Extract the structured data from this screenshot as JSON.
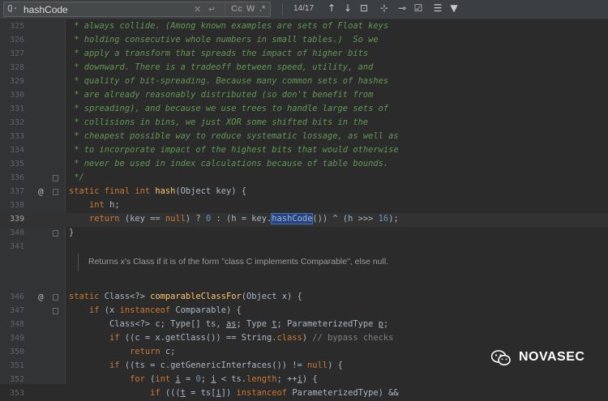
{
  "search": {
    "query": "hashCode",
    "magnifier_glyph": "Q·",
    "option_match_case": "Cc",
    "option_words": "W",
    "option_regex": ".*",
    "match_counter": "14/17"
  },
  "toolbar": {
    "icons": [
      "arrow-up-icon",
      "arrow-down-icon",
      "select-all-occurrences-icon",
      "add-occurrence-icon",
      "remove-occurrence-icon",
      "toggle-selection-icon",
      "show-filter-popup-icon",
      "filter-icon"
    ]
  },
  "editor": {
    "lines": [
      {
        "n": "325",
        "html": "<span class=\"cm\"> * always collide. (Among known examples are sets of Float keys</span>"
      },
      {
        "n": "326",
        "html": "<span class=\"cm\"> * holding consecutive whole numbers in small tables.)  So we</span>"
      },
      {
        "n": "327",
        "html": "<span class=\"cm\"> * apply a transform that spreads the impact of higher bits</span>"
      },
      {
        "n": "328",
        "html": "<span class=\"cm\"> * downward. There is a tradeoff between speed, utility, and</span>"
      },
      {
        "n": "329",
        "html": "<span class=\"cm\"> * quality of bit-spreading. Because many common sets of hashes</span>"
      },
      {
        "n": "330",
        "html": "<span class=\"cm\"> * are already reasonably distributed (so don't benefit from</span>"
      },
      {
        "n": "331",
        "html": "<span class=\"cm\"> * spreading), and because we use trees to handle large sets of</span>"
      },
      {
        "n": "332",
        "html": "<span class=\"cm\"> * collisions in bins, we just XOR some shifted bits in the</span>"
      },
      {
        "n": "333",
        "html": "<span class=\"cm\"> * cheapest possible way to reduce systematic lossage, as well as</span>"
      },
      {
        "n": "334",
        "html": "<span class=\"cm\"> * to incorporate impact of the highest bits that would otherwise</span>"
      },
      {
        "n": "335",
        "html": "<span class=\"cm\"> * never be used in index calculations because of table bounds.</span>"
      },
      {
        "n": "336",
        "html": "<span class=\"cm\"> */</span>"
      },
      {
        "n": "337",
        "html": "<span class=\"kw\">static final int</span> <span class=\"fn\">hash</span>(Object key) {"
      },
      {
        "n": "338",
        "html": "    <span class=\"kw\">int</span> h;"
      },
      {
        "n": "339",
        "html": "    <span class=\"kw\">return</span> (key == <span class=\"kw\">null</span>) ? <span class=\"num\">0</span> : (h = key.<span class=\"hl\">hashCode</span>()) ^ (h >>> <span class=\"num\">16</span>);"
      },
      {
        "n": "340",
        "html": "}"
      },
      {
        "n": "341",
        "html": ""
      },
      {
        "n": "",
        "html": ""
      },
      {
        "n": "346",
        "html": "<span class=\"kw\">static</span> Class&lt;?&gt; <span class=\"fn\">comparableClassFor</span>(Object x) {"
      },
      {
        "n": "347",
        "html": "    <span class=\"kw\">if</span> (x <span class=\"kw\">instanceof</span> Comparable) {"
      },
      {
        "n": "348",
        "html": "        Class&lt;?&gt; c; Type[] ts, <span class=\"ul\">as</span>; Type <span class=\"ul\">t</span>; ParameterizedType <span class=\"ul\">p</span>;"
      },
      {
        "n": "349",
        "html": "        <span class=\"kw\">if</span> ((c = x.getClass()) == String.<span class=\"kw\">class</span>) <span class=\"gray\">// bypass checks</span>"
      },
      {
        "n": "350",
        "html": "            <span class=\"kw\">return</span> c;"
      },
      {
        "n": "351",
        "html": "        <span class=\"kw\">if</span> ((ts = c.getGenericInterfaces()) != <span class=\"kw\">null</span>) {"
      },
      {
        "n": "352",
        "html": "            <span class=\"kw\">for</span> (<span class=\"kw\">int</span> <span class=\"ul\">i</span> = <span class=\"num\">0</span>; <span class=\"ul\">i</span> &lt; ts.<span class=\"kw\">length</span>; ++<span class=\"ul\">i</span>) {"
      },
      {
        "n": "353",
        "html": "                <span class=\"kw\">if</span> (((<span class=\"ul\">t</span> = ts[<span class=\"ul\">i</span>]) <span class=\"kw\">instanceof</span> ParameterizedType) &amp;&amp;"
      }
    ],
    "doc_note": "Returns x's Class if it is of the form \"class C implements Comparable\", else null.",
    "override_marker": "@"
  },
  "watermark": {
    "text": "NOVASEC"
  }
}
